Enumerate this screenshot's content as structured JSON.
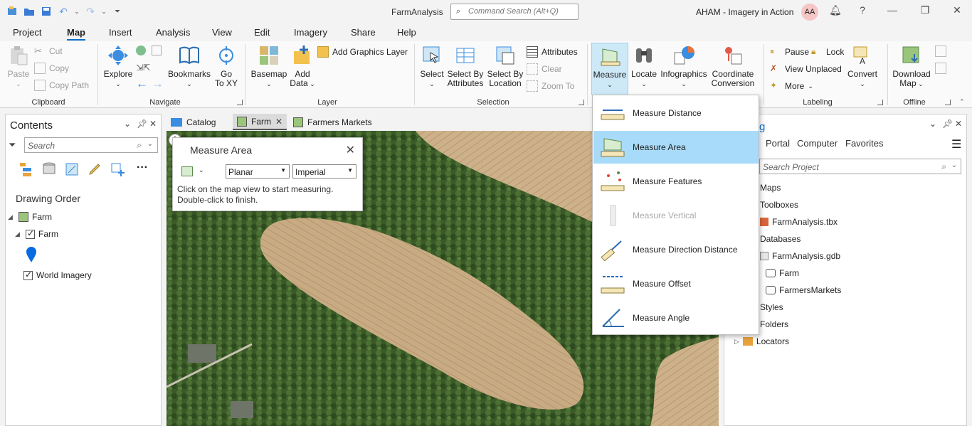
{
  "app": {
    "title": "FarmAnalysis",
    "command_search_placeholder": "Command Search (Alt+Q)",
    "account": "AHAM - Imagery in Action",
    "avatar_initials": "AA"
  },
  "tabs": [
    "Project",
    "Map",
    "Insert",
    "Analysis",
    "View",
    "Edit",
    "Imagery",
    "Share",
    "Help"
  ],
  "active_tab": "Map",
  "ribbon": {
    "clipboard": {
      "label": "Clipboard",
      "paste": "Paste",
      "cut": "Cut",
      "copy": "Copy",
      "copy_path": "Copy Path"
    },
    "navigate": {
      "label": "Navigate",
      "explore": "Explore",
      "bookmarks": "Bookmarks",
      "go_to_xy_line1": "Go",
      "go_to_xy_line2": "To XY"
    },
    "layer": {
      "label": "Layer",
      "basemap": "Basemap",
      "add_data_line1": "Add",
      "add_data_line2": "Data",
      "add_graphics_layer": "Add Graphics Layer"
    },
    "selection": {
      "label": "Selection",
      "select": "Select",
      "select_by_attributes_line1": "Select By",
      "select_by_attributes_line2": "Attributes",
      "select_by_location_line1": "Select By",
      "select_by_location_line2": "Location",
      "attributes": "Attributes",
      "clear": "Clear",
      "zoom_to": "Zoom To"
    },
    "inquiry": {
      "measure": "Measure",
      "locate": "Locate",
      "infographics": "Infographics",
      "coordinate_conversion_line1": "Coordinate",
      "coordinate_conversion_line2": "Conversion"
    },
    "labeling": {
      "label": "Labeling",
      "pause": "Pause",
      "lock": "Lock",
      "view_unplaced": "View Unplaced",
      "more": "More",
      "convert": "Convert"
    },
    "offline": {
      "label": "Offline",
      "download_map_line1": "Download",
      "download_map_line2": "Map"
    }
  },
  "contents": {
    "title": "Contents",
    "search_placeholder": "Search",
    "drawing_order": "Drawing Order",
    "map_name": "Farm",
    "layers": [
      "Farm",
      "World Imagery"
    ]
  },
  "doc_tabs": [
    "Catalog",
    "Farm",
    "Farmers Markets"
  ],
  "active_doc_tab": "Farm",
  "measure_window": {
    "title": "Measure Area",
    "mode": "Planar",
    "units": "Imperial",
    "instruction_line1": "Click on the map view to start measuring.",
    "instruction_line2": "Double-click to finish."
  },
  "measure_menu": [
    {
      "label": "Measure Distance",
      "enabled": true,
      "highlighted": false
    },
    {
      "label": "Measure Area",
      "enabled": true,
      "highlighted": true
    },
    {
      "label": "Measure Features",
      "enabled": true,
      "highlighted": false
    },
    {
      "label": "Measure Vertical",
      "enabled": false,
      "highlighted": false
    },
    {
      "label": "Measure Direction Distance",
      "enabled": true,
      "highlighted": false
    },
    {
      "label": "Measure Offset",
      "enabled": true,
      "highlighted": false
    },
    {
      "label": "Measure Angle",
      "enabled": true,
      "highlighted": false
    }
  ],
  "catalog": {
    "title_partial": "g",
    "tabs": [
      "Portal",
      "Computer",
      "Favorites"
    ],
    "search_placeholder": "Search Project",
    "items": [
      "Maps",
      "Toolboxes",
      "FarmAnalysis.tbx",
      "Databases",
      "FarmAnalysis.gdb",
      "Farm",
      "FarmersMarkets",
      "Styles",
      "Folders",
      "Locators"
    ]
  },
  "colors": {
    "accent": "#0b6ec5",
    "menu_highlight": "#a8dbfa",
    "measure_button": "#cde8f7"
  }
}
